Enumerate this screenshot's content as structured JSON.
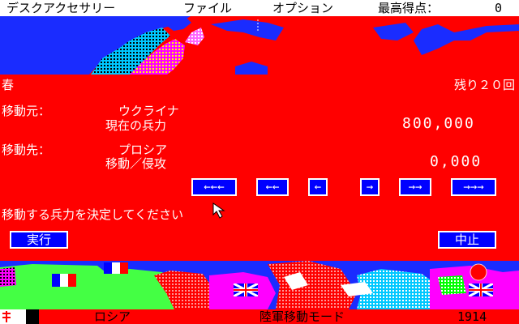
{
  "menu": {
    "desk_accessory": "デスクアクセサリー",
    "file": "ファイル",
    "options": "オプション",
    "high_score_label": "最高得点：",
    "high_score_value": "0"
  },
  "panel": {
    "season": "春",
    "turns_left": "残り２０回",
    "source_label": "移動元：",
    "source_region": "ウクライナ",
    "current_troops_label": "現在の兵力",
    "current_troops_value": "800,000",
    "dest_label": "移動先：",
    "dest_region": "プロシア",
    "move_invade_label": "移動／侵攻",
    "move_value": "0,000",
    "prompt": "移動する兵力を決定してください",
    "arrows": [
      "←←←",
      "←←",
      "←",
      "→",
      "→→",
      "→→→"
    ],
    "execute_label": "実行",
    "cancel_label": "中止"
  },
  "status": {
    "nation": "ロシア",
    "mode": "陸軍移動モード",
    "year": "1914"
  },
  "colors": {
    "panel_bg": "#ff0000",
    "button_bg": "#0000ff",
    "sea": "#1a2cff",
    "menubar_bg": "#ffffff"
  },
  "icons": [
    "mouse-cursor-icon",
    "france-flag-icon",
    "uk-flag-icon",
    "russia-flag-icon"
  ]
}
